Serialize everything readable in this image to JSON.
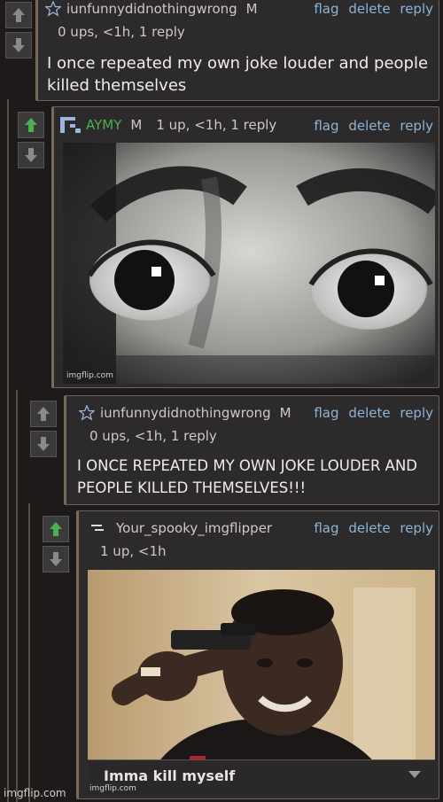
{
  "comments": [
    {
      "username": "iunfunnydidnothingwrong",
      "badge": "M",
      "meta": "0 ups, <1h, 1 reply",
      "actions": [
        "flag",
        "delete",
        "reply"
      ],
      "text": "I once repeated my own joke louder and people killed themselves"
    },
    {
      "username": "AYMY",
      "badge": "M",
      "meta": "1 up, <1h, 1 reply",
      "actions": [
        "flag",
        "delete",
        "reply"
      ],
      "image_watermark": "imgflip.com"
    },
    {
      "username": "iunfunnydidnothingwrong",
      "badge": "M",
      "meta": "0 ups, <1h, 1 reply",
      "actions": [
        "flag",
        "delete",
        "reply"
      ],
      "text": "I ONCE REPEATED MY OWN JOKE LOUDER AND PEOPLE KILLED THEMSELVES!!!"
    },
    {
      "username": "Your_spooky_imgflipper",
      "meta": "1 up, <1h",
      "actions": [
        "flag",
        "delete",
        "reply"
      ],
      "image_caption": "Imma kill myself",
      "image_watermark": "imgflip.com"
    }
  ],
  "footer": {
    "watermark": "imgflip.com"
  },
  "colors": {
    "link": "#8cb4d8",
    "upvote_active": "#4caf50",
    "background": "#1e1a1a"
  }
}
